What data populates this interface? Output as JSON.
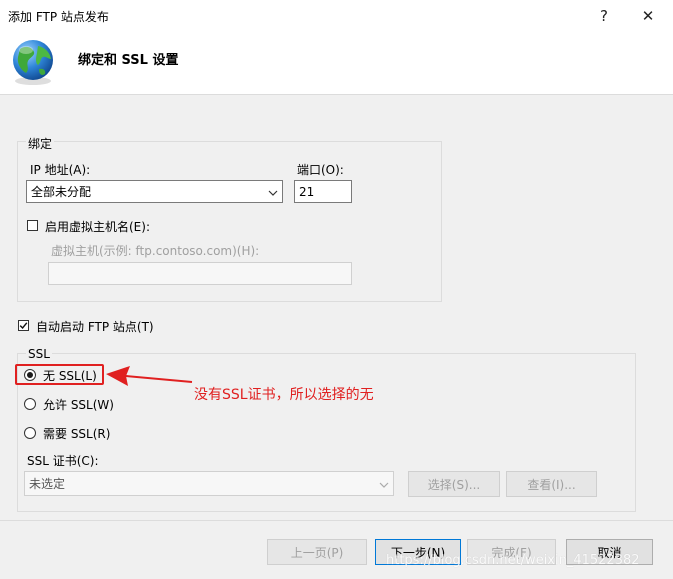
{
  "window": {
    "title": "添加 FTP 站点发布",
    "help_symbol": "?",
    "close_symbol": "✕"
  },
  "header": {
    "title": "绑定和 SSL 设置"
  },
  "binding": {
    "group_label": "绑定",
    "ip_label": "IP 地址(A):",
    "ip_value": "全部未分配",
    "port_label": "端口(O):",
    "port_value": "21",
    "virtual_host_checkbox_label": "启用虚拟主机名(E):",
    "virtual_host_field_label": "虚拟主机(示例: ftp.contoso.com)(H):",
    "virtual_host_value": ""
  },
  "autostart": {
    "label": "自动启动 FTP 站点(T)",
    "checked": true
  },
  "ssl": {
    "group_label": "SSL",
    "options": [
      {
        "label": "无 SSL(L)",
        "checked": true
      },
      {
        "label": "允许 SSL(W)",
        "checked": false
      },
      {
        "label": "需要 SSL(R)",
        "checked": false
      }
    ],
    "cert_label": "SSL 证书(C):",
    "cert_value": "未选定",
    "select_button": "选择(S)...",
    "view_button": "查看(I)..."
  },
  "annotation": {
    "text": "没有SSL证书，所以选择的无",
    "color": "#e02020"
  },
  "footer": {
    "prev_button": "上一页(P)",
    "next_button": "下一步(N)",
    "finish_button": "完成(F)",
    "cancel_button": "取消"
  },
  "watermark": {
    "text": "https://blog.csdn.net/weixin_41522382"
  }
}
